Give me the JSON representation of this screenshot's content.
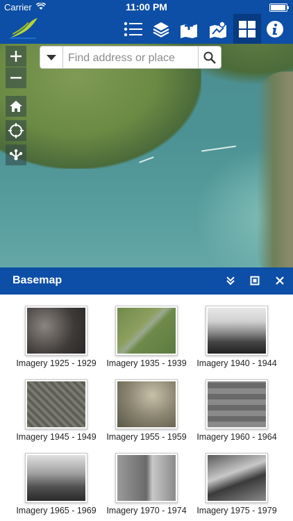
{
  "status_bar": {
    "carrier": "Carrier",
    "time": "11:00 PM"
  },
  "toolbar": {
    "logo": "app-logo",
    "buttons": [
      {
        "name": "legend-list-icon"
      },
      {
        "name": "layers-icon"
      },
      {
        "name": "add-map-icon"
      },
      {
        "name": "map-tools-icon"
      },
      {
        "name": "basemap-gallery-icon",
        "active": true
      },
      {
        "name": "info-icon"
      }
    ]
  },
  "search": {
    "placeholder": "Find address or place"
  },
  "basemap_panel": {
    "title": "Basemap",
    "items": [
      {
        "label": "Imagery 1925 - 1929"
      },
      {
        "label": "Imagery 1935 - 1939"
      },
      {
        "label": "Imagery 1940 - 1944"
      },
      {
        "label": "Imagery 1945 - 1949"
      },
      {
        "label": "Imagery 1955 - 1959"
      },
      {
        "label": "Imagery 1960 - 1964"
      },
      {
        "label": "Imagery 1965 - 1969"
      },
      {
        "label": "Imagery 1970 - 1974"
      },
      {
        "label": "Imagery 1975 - 1979"
      }
    ]
  },
  "colors": {
    "header_blue": "#0d4ea6",
    "active_blue": "#073b82"
  }
}
